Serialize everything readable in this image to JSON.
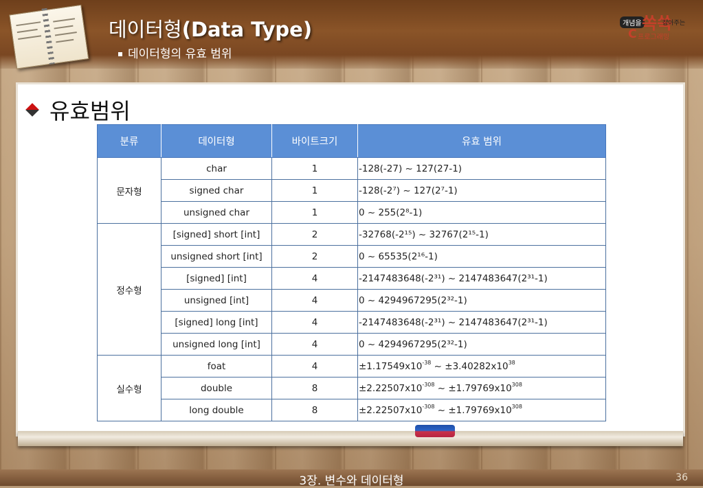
{
  "header": {
    "title_ko": "데이터형",
    "title_en": "(Data Type)",
    "subtitle": "데이터형의 유효 범위"
  },
  "logo": {
    "tag": "개념을",
    "big": "쏙쏙",
    "small1": "잡아주는",
    "c": "C",
    "small2": "프로그래밍"
  },
  "section": {
    "heading": "유효범위"
  },
  "table": {
    "headers": [
      "분류",
      "데이터형",
      "바이트크기",
      "유효 범위"
    ],
    "groups": [
      {
        "category": "문자형",
        "rows": [
          {
            "type": "char",
            "size": "1",
            "range": "-128(-27) ~ 127(27-1)"
          },
          {
            "type": "signed char",
            "size": "1",
            "range": "-128(-2⁷) ~ 127(2⁷-1)"
          },
          {
            "type": "unsigned char",
            "size": "1",
            "range": "0 ~ 255(2⁸-1)"
          }
        ]
      },
      {
        "category": "정수형",
        "rows": [
          {
            "type": "[signed] short [int]",
            "size": "2",
            "range": "-32768(-2¹⁵) ~ 32767(2¹⁵-1)"
          },
          {
            "type": "unsigned short [int]",
            "size": "2",
            "range": "0 ~ 65535(2¹⁶-1)"
          },
          {
            "type": "[signed] [int]",
            "size": "4",
            "range": "-2147483648(-2³¹)  ~ 2147483647(2³¹-1)"
          },
          {
            "type": "unsigned [int]",
            "size": "4",
            "range": "0 ~ 4294967295(2³²-1)"
          },
          {
            "type": "[signed] long [int]",
            "size": "4",
            "range": "-2147483648(-2³¹)  ~ 2147483647(2³¹-1)"
          },
          {
            "type": "unsigned long [int]",
            "size": "4",
            "range": "0 ~ 4294967295(2³²-1)"
          }
        ]
      },
      {
        "category": "실수형",
        "rows": [
          {
            "type": "foat",
            "size": "4",
            "range_a": "±1.17549x10",
            "exp_a": "-38",
            "range_b": " ~ ±3.40282x10",
            "exp_b": "38"
          },
          {
            "type": "double",
            "size": "8",
            "range_a": "±2.22507x10",
            "exp_a": "-308",
            "range_b": " ~ ±1.79769x10",
            "exp_b": "308"
          },
          {
            "type": "long double",
            "size": "8",
            "range_a": "±2.22507x10",
            "exp_a": "-308",
            "range_b": " ~ ±1.79769x10",
            "exp_b": "308"
          }
        ]
      }
    ]
  },
  "footer": {
    "chapter": "3장. 변수와 데이터형",
    "page": "36"
  }
}
